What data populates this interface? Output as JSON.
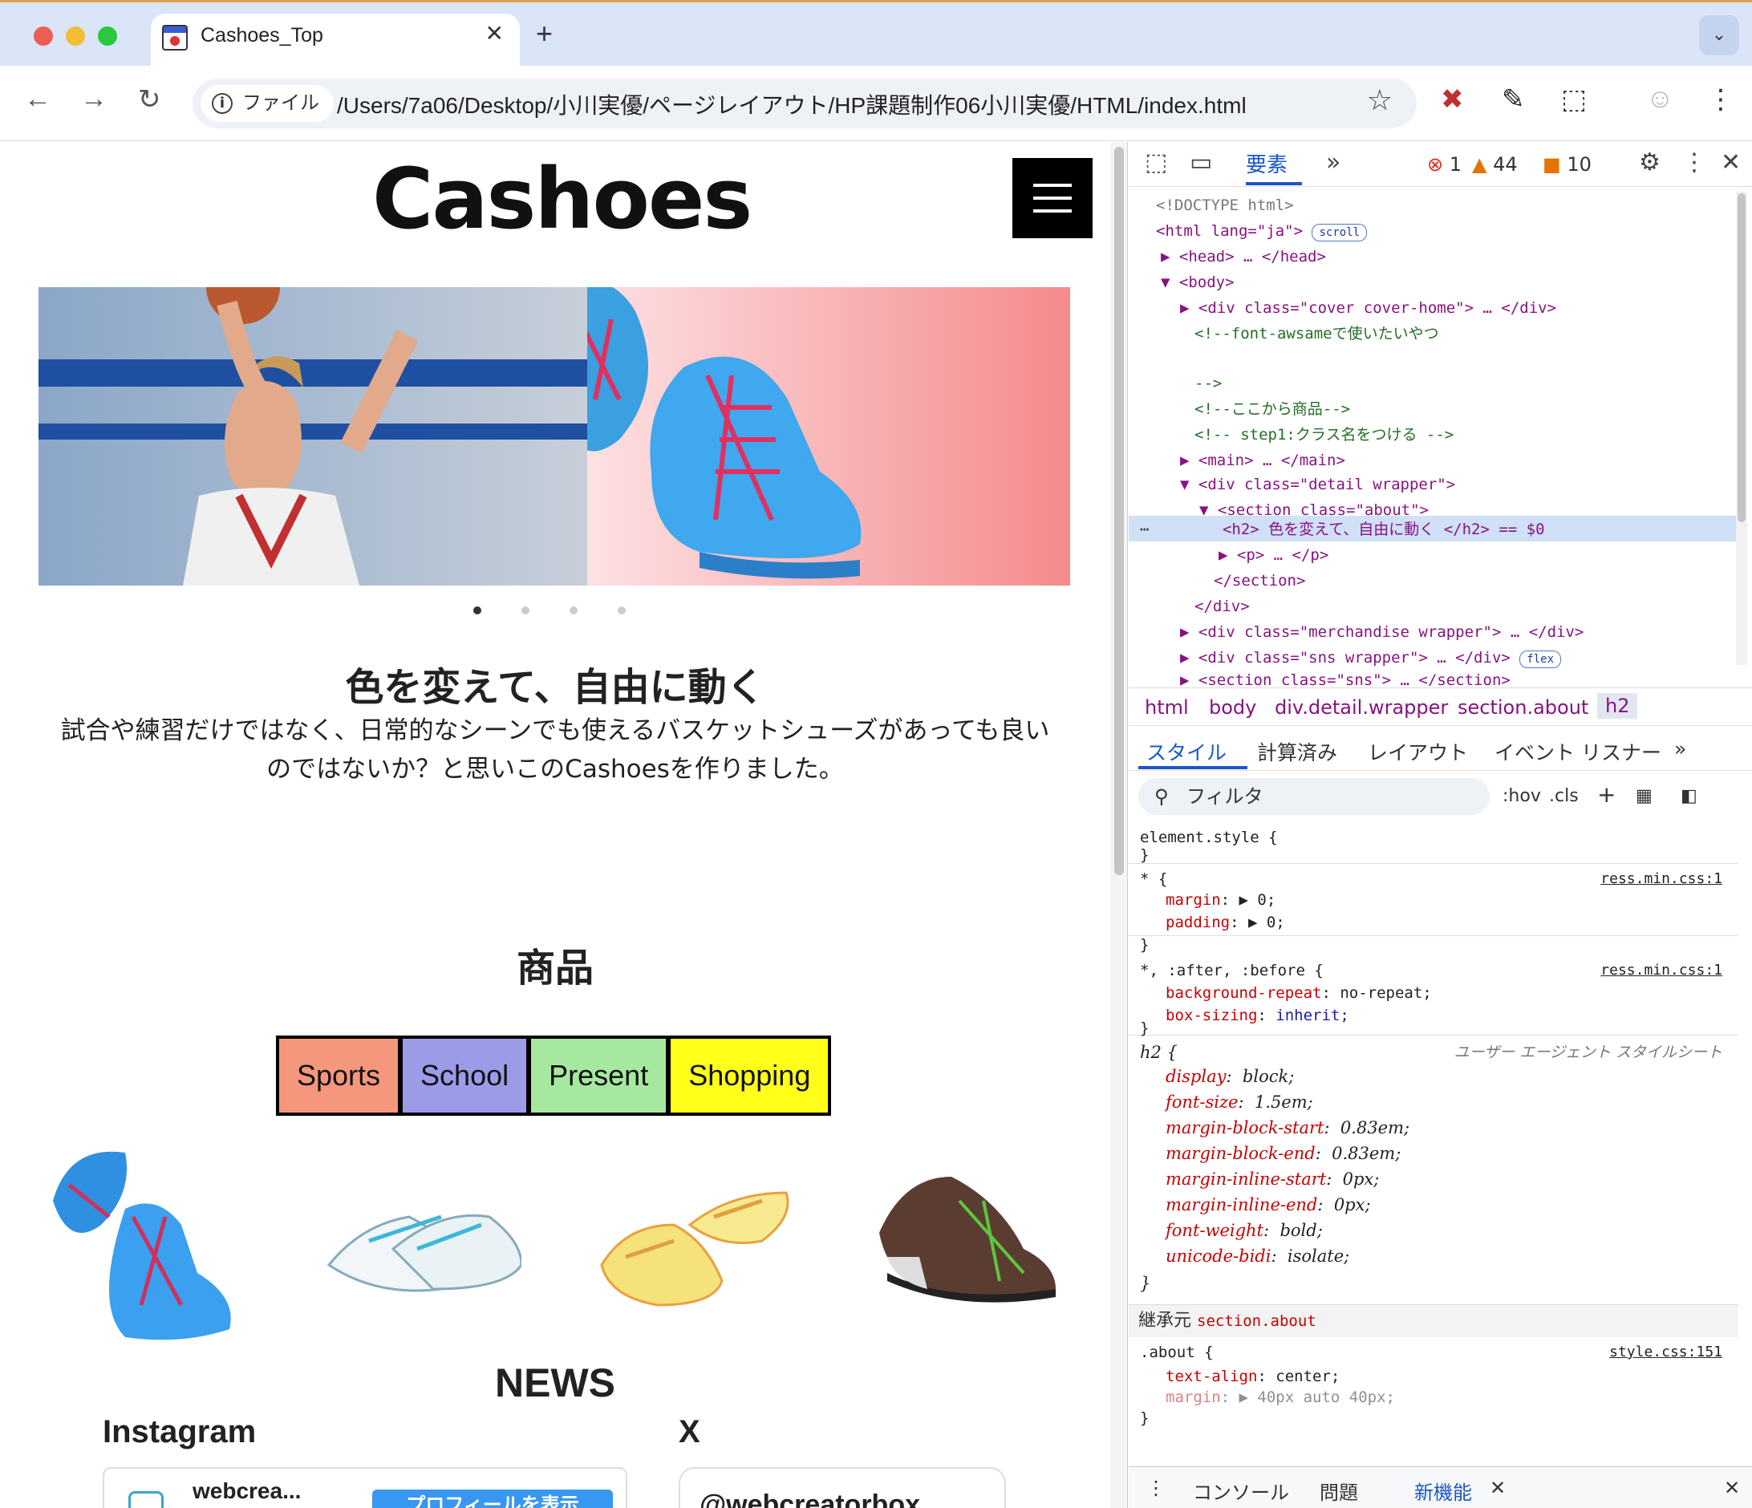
{
  "browser": {
    "tab_title": "Cashoes_Top",
    "new_tab": "+",
    "chip_label": "ファイル",
    "url": "/Users/7a06/Desktop/小川実優/ページレイアウト/HP課題制作06小川実優/HTML/index.html",
    "colors": {
      "close": "#ee5d55",
      "minimize": "#f5bd35",
      "maximize": "#28c840"
    }
  },
  "site": {
    "logo": "Cashoes",
    "about": {
      "heading": "色を変えて、自由に動く",
      "text_line1": "試合や練習だけではなく、日常的なシーンでも使えるバスケットシューズがあっても良い",
      "text_line2": "のではないか？と思いこのCashoesを作りました。"
    },
    "slider_dots": 4,
    "slider_active": 1,
    "merchandise_heading": "商品",
    "categories": [
      {
        "label": "Sports",
        "color": "#f4977c"
      },
      {
        "label": "School",
        "color": "#9b9be8"
      },
      {
        "label": "Present",
        "color": "#a6e8a0"
      },
      {
        "label": "Shopping",
        "color": "#ffff1a"
      }
    ],
    "news_heading": "NEWS",
    "instagram_heading": "Instagram",
    "x_heading": "X",
    "instagram_card_name": "webcrea...",
    "instagram_card_button": "プロフィールを表示",
    "x_card_handle": "@webcreatorbox"
  },
  "devtools": {
    "tab_elements": "要素",
    "errors": "1",
    "warnings": "44",
    "issues": "10",
    "dom_lines": [
      "<!DOCTYPE html>",
      "<html lang=\"ja\">",
      "<head> … </head>",
      "<body>",
      "<div class=\"cover cover-home\"> … </div>",
      "<!--font-awsameで使いたいやつ",
      "-->",
      "<!--ここから商品-->",
      "<!-- step1:クラス名をつける -->",
      "<main> … </main>",
      "<div class=\"detail wrapper\">",
      "<section class=\"about\">",
      "<h2> 色を変えて、自由に動く </h2> == $0",
      "<p> … </p>",
      "</section>",
      "</div>",
      "<div class=\"merchandise wrapper\"> … </div>",
      "<div class=\"sns wrapper\"> … </div>",
      "<section class=\"sns\"> … </section>"
    ],
    "pill_scroll": "scroll",
    "pill_flex": "flex",
    "breadcrumbs": [
      "html",
      "body",
      "div.detail.wrapper",
      "section.about",
      "h2"
    ],
    "subtabs": [
      "スタイル",
      "計算済み",
      "レイアウト",
      "イベント リスナー"
    ],
    "filter_placeholder": "フィルタ",
    "filter_hov": ":hov",
    "filter_cls": ".cls",
    "rules": {
      "element_style": "element.style {",
      "close": "}",
      "star_selector": "* {",
      "star_src": "ress.min.css:1",
      "margin": "margin",
      "margin_val": "0;",
      "padding": "padding",
      "padding_val": "0;",
      "after_selector": "*, :after, :before {",
      "after_src": "ress.min.css:1",
      "bg_repeat": "background-repeat",
      "bg_repeat_val": "no-repeat;",
      "box_sizing": "box-sizing",
      "box_sizing_val": "inherit;",
      "h2_selector": "h2 {",
      "ua_label": "ユーザー エージェント スタイルシート",
      "h2_props": [
        [
          "display",
          "block;"
        ],
        [
          "font-size",
          "1.5em;"
        ],
        [
          "margin-block-start",
          "0.83em;"
        ],
        [
          "margin-block-end",
          "0.83em;"
        ],
        [
          "margin-inline-start",
          "0px;"
        ],
        [
          "margin-inline-end",
          "0px;"
        ],
        [
          "font-weight",
          "bold;"
        ],
        [
          "unicode-bidi",
          "isolate;"
        ]
      ],
      "inherited_label": "継承元",
      "inherited_from": "section.about",
      "about_selector": ".about {",
      "about_src": "style.css:151",
      "text_align": "text-align",
      "text_align_val": "center;",
      "about_margin": "margin",
      "about_margin_val": "40px auto 40px;"
    },
    "drawer": {
      "console": "コンソール",
      "issues": "問題",
      "whats_new": "新機能"
    }
  }
}
